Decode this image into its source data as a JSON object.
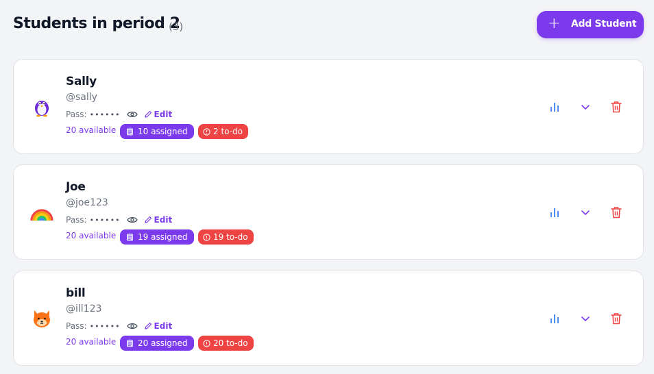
{
  "header": {
    "title": "Students in period 2",
    "count": "(3)",
    "add_button_label": "Add Student",
    "add_button_icon": "plus-icon"
  },
  "labels": {
    "pass": "Pass:",
    "pass_dots": "••••••",
    "edit": "Edit"
  },
  "colors": {
    "accent": "#7c3aed",
    "danger": "#ef4444",
    "stats": "#3b82f6"
  },
  "students": [
    {
      "avatar": "penguin-icon",
      "name": "Sally",
      "username": "@sally",
      "available": "20 available",
      "assigned": "10 assigned",
      "todo": "2 to-do"
    },
    {
      "avatar": "rainbow-icon",
      "name": "Joe",
      "username": "@joe123",
      "available": "20 available",
      "assigned": "19 assigned",
      "todo": "19 to-do"
    },
    {
      "avatar": "fox-icon",
      "name": "bill",
      "username": "@ill123",
      "available": "20 available",
      "assigned": "20 assigned",
      "todo": "20 to-do"
    }
  ]
}
